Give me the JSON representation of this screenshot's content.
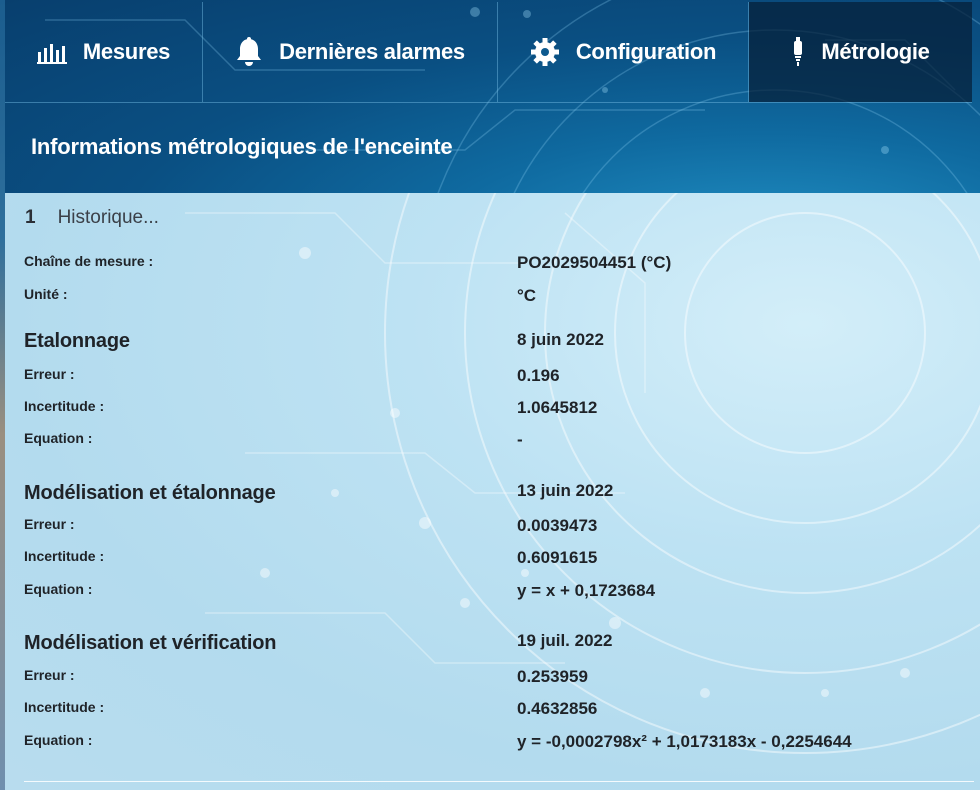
{
  "tabs": [
    {
      "label": "Mesures",
      "icon": "bar-chart-icon",
      "active": false
    },
    {
      "label": "Dernières alarmes",
      "icon": "bell-icon",
      "active": false
    },
    {
      "label": "Configuration",
      "icon": "gear-icon",
      "active": false
    },
    {
      "label": "Métrologie",
      "icon": "thermometer-probe-icon",
      "active": true
    }
  ],
  "section_title": "Informations métrologiques de l'enceinte",
  "history": {
    "number": "1",
    "label": "Historique..."
  },
  "chain": {
    "label": "Chaîne de mesure :",
    "value": "PO2029504451 (°C)",
    "unit_label": "Unité :",
    "unit_value": "°C"
  },
  "blocks": [
    {
      "title": "Etalonnage",
      "date": "8 juin 2022",
      "erreur_label": "Erreur :",
      "erreur": "0.196",
      "incertitude_label": "Incertitude :",
      "incertitude": "1.0645812",
      "equation_label": "Equation :",
      "equation": "-"
    },
    {
      "title": "Modélisation et étalonnage",
      "date": "13 juin 2022",
      "erreur_label": "Erreur :",
      "erreur": "0.0039473",
      "incertitude_label": "Incertitude :",
      "incertitude": "0.6091615",
      "equation_label": "Equation :",
      "equation": "y = x + 0,1723684"
    },
    {
      "title": "Modélisation et vérification",
      "date": "19 juil. 2022",
      "erreur_label": "Erreur :",
      "erreur": "0.253959",
      "incertitude_label": "Incertitude :",
      "incertitude": "0.4632856",
      "equation_label": "Equation :",
      "equation": "y = -0,0002798x² + 1,0173183x - 0,2254644"
    }
  ],
  "colors": {
    "header": "#0a4f82",
    "active_tab": "#061e37",
    "content": "#b9dcee",
    "text": "#1f2328"
  }
}
